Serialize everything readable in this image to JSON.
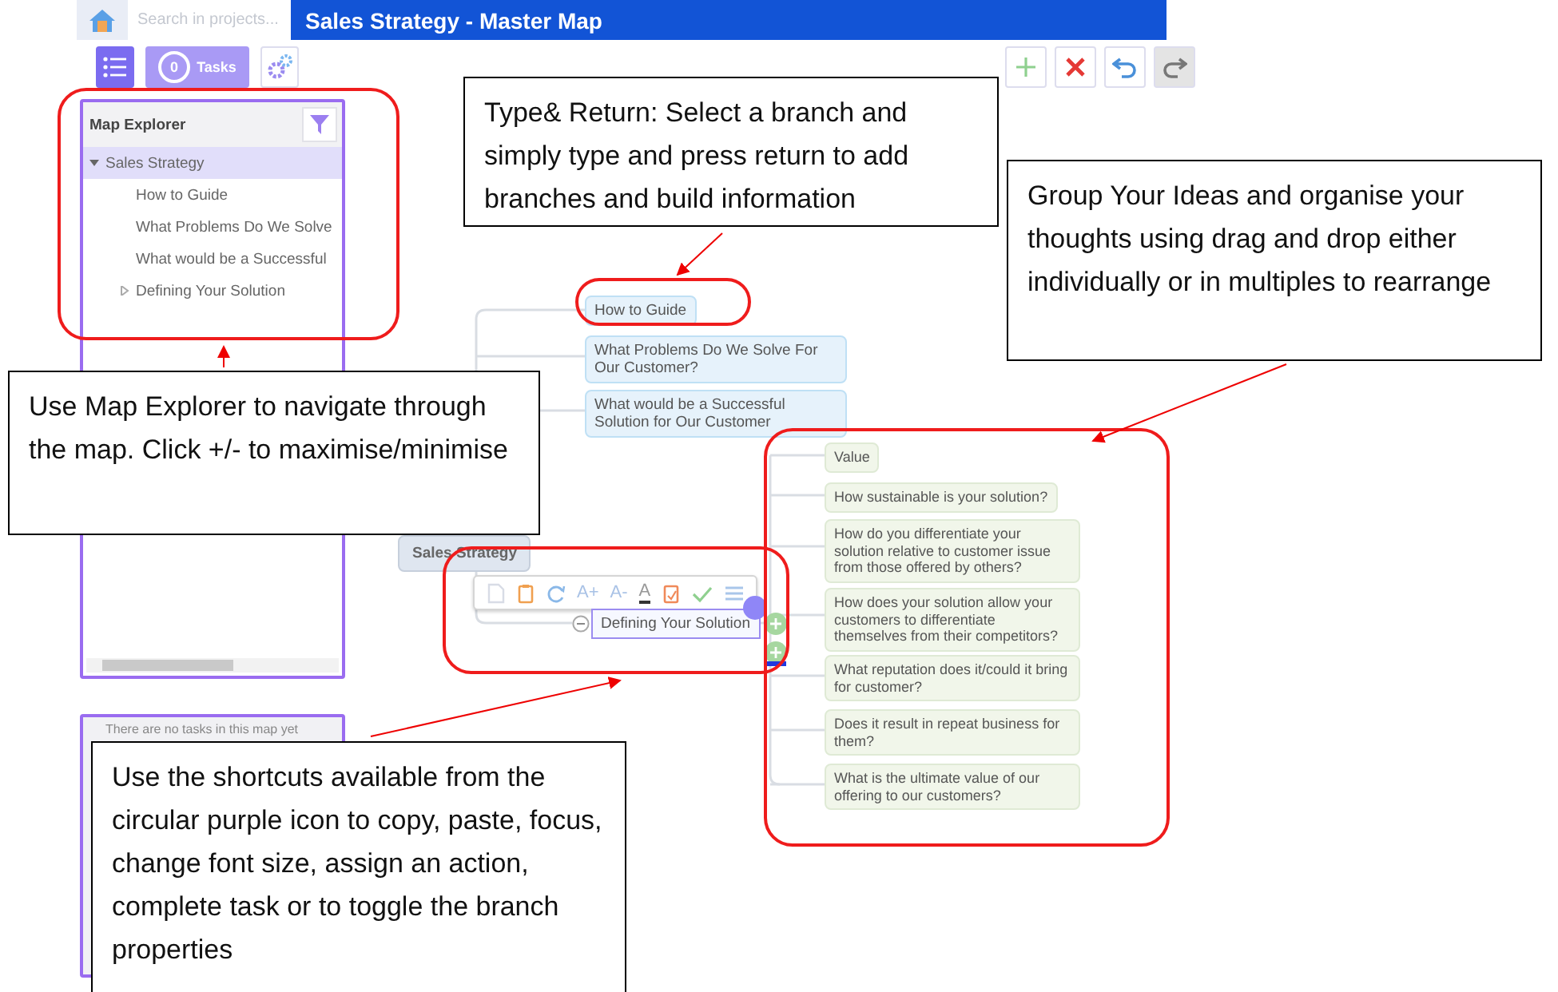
{
  "header": {
    "search": {
      "placeholder": "Search in projects..."
    },
    "title": "Sales Strategy - Master Map"
  },
  "toolbar": {
    "tasks": {
      "count": "0",
      "label": "Tasks"
    },
    "actions": [
      {
        "kind": "add",
        "disabled": false
      },
      {
        "kind": "delete",
        "disabled": false
      },
      {
        "kind": "undo",
        "disabled": false
      },
      {
        "kind": "redo",
        "disabled": true
      }
    ]
  },
  "explorer": {
    "title": "Map Explorer",
    "tree": [
      {
        "label": "Sales Strategy",
        "expanded": true,
        "selected": true,
        "children": [
          {
            "label": "How to Guide",
            "selected": false
          },
          {
            "label": "What Problems Do We Solve",
            "selected": false
          },
          {
            "label": "What would be a Successful",
            "selected": false
          },
          {
            "label": "Defining Your Solution",
            "selected": false,
            "expanded": false
          }
        ]
      }
    ]
  },
  "tasks_panel": {
    "message": "There are no tasks in this map yet"
  },
  "map": {
    "root": "Sales Strategy",
    "branches": [
      "How to Guide",
      "What Problems Do We Solve For Our Customer?",
      "What would be a Successful Solution for Our Customer"
    ],
    "selected_branch": "Defining Your Solution",
    "node_toolbar": [
      {
        "kind": "copy"
      },
      {
        "kind": "paste"
      },
      {
        "kind": "focus"
      },
      {
        "kind": "grow",
        "glyph": "A+"
      },
      {
        "kind": "shrink",
        "glyph": "A-"
      },
      {
        "kind": "color",
        "glyph": "A"
      },
      {
        "kind": "task"
      },
      {
        "kind": "complete"
      },
      {
        "kind": "properties"
      }
    ],
    "sub_branches": [
      "Value",
      "How sustainable is your solution?",
      "How do you differentiate your solution relative to customer issue from those offered by others?",
      "How does your solution allow your customers to differentiate themselves from their competitors?",
      "What reputation does it/could it bring for customer?",
      "Does it result in repeat business for them?",
      "What is the ultimate value of our offering to our customers?"
    ]
  },
  "callouts": [
    "Type& Return: Select a branch and simply type and press return to add branches and build information",
    "Group Your Ideas and organise your thoughts using drag and drop either individually or in multiples to rearrange",
    "Use Map Explorer to navigate through the map. Click +/- to maximise/minimise",
    "Use the shortcuts available from the circular purple icon to copy, paste, focus, change font size, assign an action, complete task or to toggle the branch properties"
  ]
}
